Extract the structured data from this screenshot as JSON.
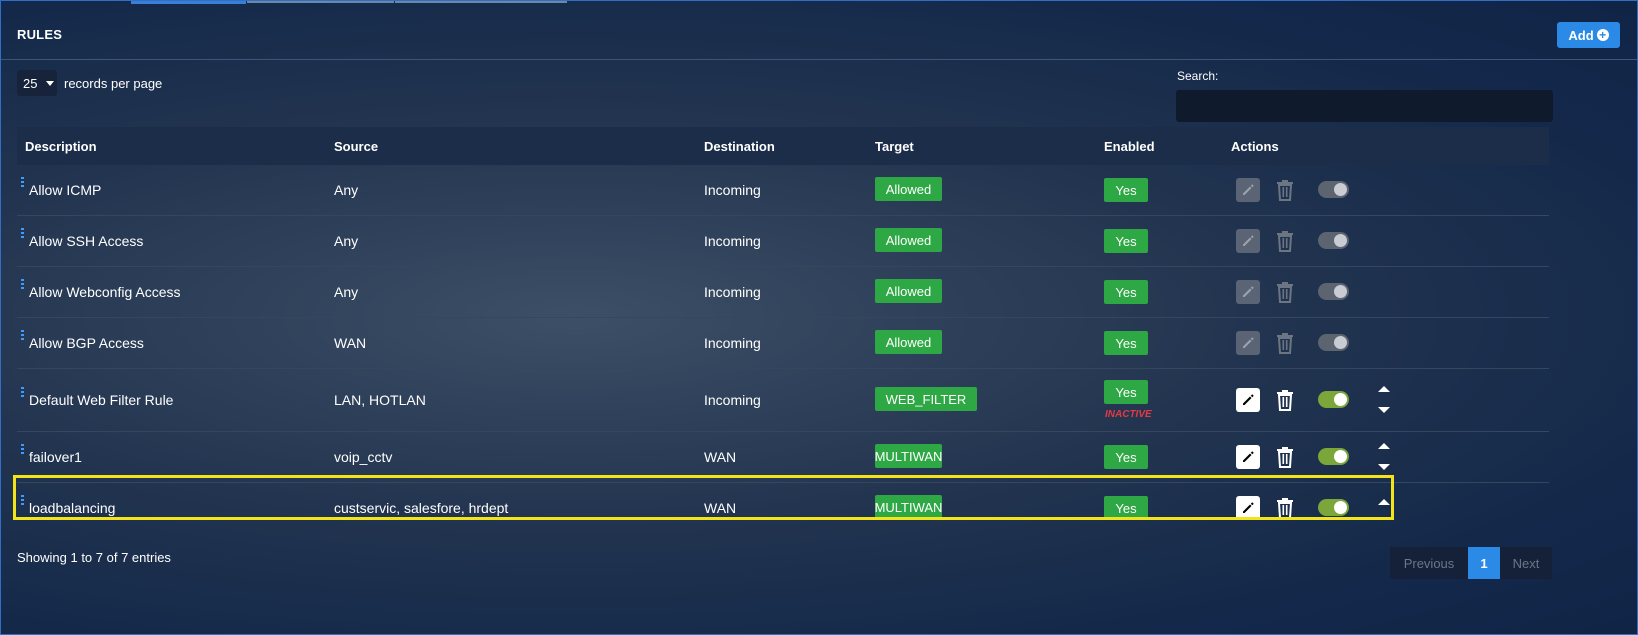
{
  "panel": {
    "title": "RULES",
    "add_label": "Add"
  },
  "length": {
    "value": "25",
    "label": "records per page"
  },
  "search": {
    "label": "Search:",
    "value": ""
  },
  "columns": [
    "Description",
    "Source",
    "Destination",
    "Target",
    "Enabled",
    "Actions"
  ],
  "rows": [
    {
      "description": "Allow ICMP",
      "source": "Any",
      "destination": "Incoming",
      "target": "Allowed",
      "enabled": "Yes",
      "status": "",
      "editable": false
    },
    {
      "description": "Allow SSH Access",
      "source": "Any",
      "destination": "Incoming",
      "target": "Allowed",
      "enabled": "Yes",
      "status": "",
      "editable": false
    },
    {
      "description": "Allow Webconfig Access",
      "source": "Any",
      "destination": "Incoming",
      "target": "Allowed",
      "enabled": "Yes",
      "status": "",
      "editable": false
    },
    {
      "description": "Allow BGP Access",
      "source": "WAN",
      "destination": "Incoming",
      "target": "Allowed",
      "enabled": "Yes",
      "status": "",
      "editable": false
    },
    {
      "description": "Default Web Filter Rule",
      "source": "LAN, HOTLAN",
      "destination": "Incoming",
      "target": "WEB_FILTER",
      "enabled": "Yes",
      "status": "INACTIVE",
      "editable": true
    },
    {
      "description": "failover1",
      "source": "voip_cctv",
      "destination": "WAN",
      "target": "MULTIWAN",
      "enabled": "Yes",
      "status": "",
      "editable": true
    },
    {
      "description": "loadbalancing",
      "source": "custservic, salesfore, hrdept",
      "destination": "WAN",
      "target": "MULTIWAN",
      "enabled": "Yes",
      "status": "",
      "editable": true
    }
  ],
  "footer": {
    "info": "Showing 1 to 7 of 7 entries",
    "previous": "Previous",
    "page": "1",
    "next": "Next"
  },
  "colors": {
    "accent": "#2a8ae5",
    "success": "#2ea844",
    "highlight": "#f2e31b",
    "inactive": "#e53945",
    "toggle_on": "#7aa63a"
  }
}
